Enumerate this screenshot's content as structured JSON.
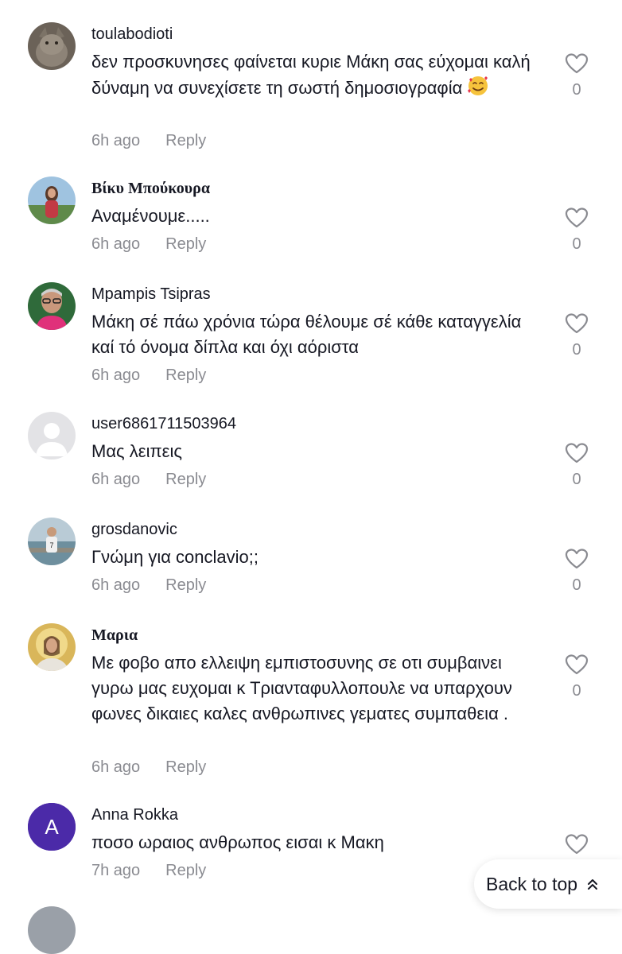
{
  "colors": {
    "text": "#161823",
    "muted": "#8a8b91",
    "heart": "#8a8b91",
    "letter_avatar": "#4b2aa8"
  },
  "comments": [
    {
      "username": "toulabodioti",
      "text": "δεν προσκυνησες φαίνεται κυριε Μάκη σας εύχομαι καλή δύναμη να συνεχίσετε τη σωστή δημοσιογραφία",
      "emoji": "smiling-face-with-hearts",
      "time": "6h ago",
      "reply": "Reply",
      "likes": "0"
    },
    {
      "username": "Βίκυ Μπούκουρα",
      "text": "Αναμένουμε.....",
      "time": "6h ago",
      "reply": "Reply",
      "likes": "0"
    },
    {
      "username": "Mpampis Tsipras",
      "text": "Μάκη σέ πάω χρόνια τώρα θέλουμε σέ κάθε καταγγελία καί τό όνομα δίπλα και όχι αόριστα",
      "time": "6h ago",
      "reply": "Reply",
      "likes": "0"
    },
    {
      "username": "user6861711503964",
      "text": "Μας λειπεις",
      "time": "6h ago",
      "reply": "Reply",
      "likes": "0"
    },
    {
      "username": "grosdanovic",
      "text": "Γνώμη για conclavio;;",
      "time": "6h ago",
      "reply": "Reply",
      "likes": "0"
    },
    {
      "username": "Μαρια",
      "text": "Με φοβο απο ελλειψη εμπιστοσυνης σε οτι συμβαινει γυρω μας ευχομαι κ Τριανταφυλλοπουλε να υπαρχουν φωνες δικαιες καλες ανθρωπινες γεματες συμπαθεια .",
      "time": "6h ago",
      "reply": "Reply",
      "likes": "0"
    },
    {
      "username": "Anna Rokka",
      "avatar_letter": "A",
      "text": "ποσο ωραιος ανθρωπος εισαι κ Μακη",
      "time": "7h ago",
      "reply": "Reply"
    }
  ],
  "back_to_top": {
    "label": "Back to top",
    "icon": "double-chevron-up-icon"
  }
}
